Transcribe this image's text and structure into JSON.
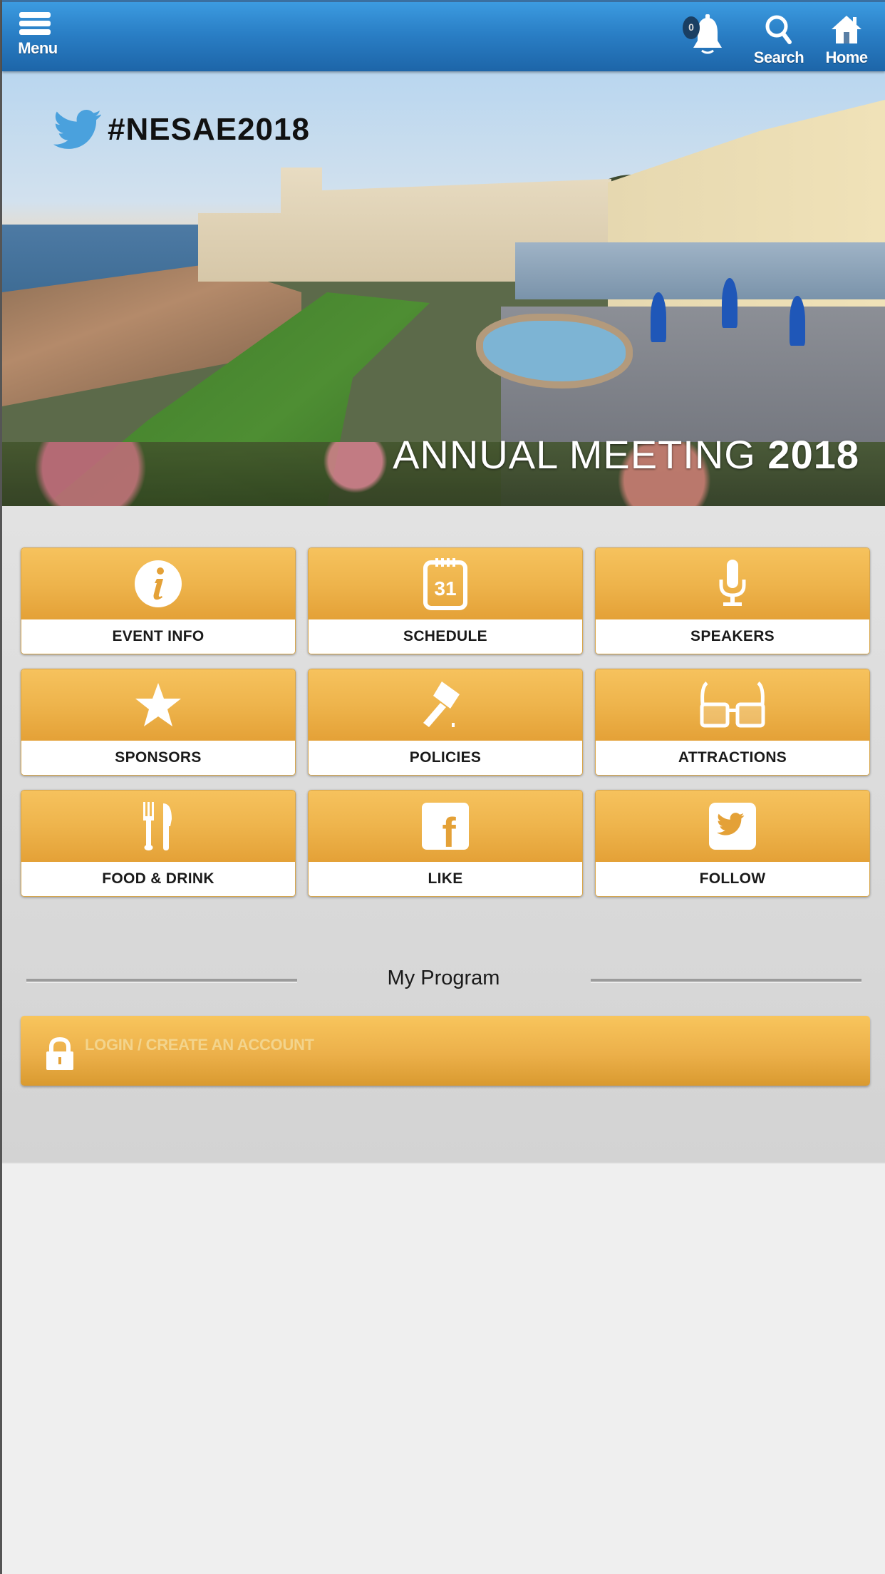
{
  "header": {
    "menu_label": "Menu",
    "notifications_count": "0",
    "search_label": "Search",
    "home_label": "Home"
  },
  "hero": {
    "hashtag": "#NESAE2018",
    "title_light": "ANNUAL MEETING",
    "title_bold": "2018"
  },
  "tiles": [
    {
      "label": "EVENT INFO",
      "icon": "info-icon"
    },
    {
      "label": "SCHEDULE",
      "icon": "calendar-icon",
      "icon_text": "31"
    },
    {
      "label": "SPEAKERS",
      "icon": "microphone-icon"
    },
    {
      "label": "SPONSORS",
      "icon": "star-icon"
    },
    {
      "label": "POLICIES",
      "icon": "gavel-icon"
    },
    {
      "label": "ATTRACTIONS",
      "icon": "glasses-icon"
    },
    {
      "label": "FOOD & DRINK",
      "icon": "fork-knife-icon"
    },
    {
      "label": "LIKE",
      "icon": "facebook-icon",
      "icon_text": "f"
    },
    {
      "label": "FOLLOW",
      "icon": "twitter-icon"
    }
  ],
  "my_program": {
    "heading": "My Program",
    "login_label": "LOGIN / CREATE AN ACCOUNT"
  },
  "colors": {
    "header_blue": "#2a7fc6",
    "tile_gold": "#eeb44c",
    "twitter_blue": "#4aa1dd"
  }
}
